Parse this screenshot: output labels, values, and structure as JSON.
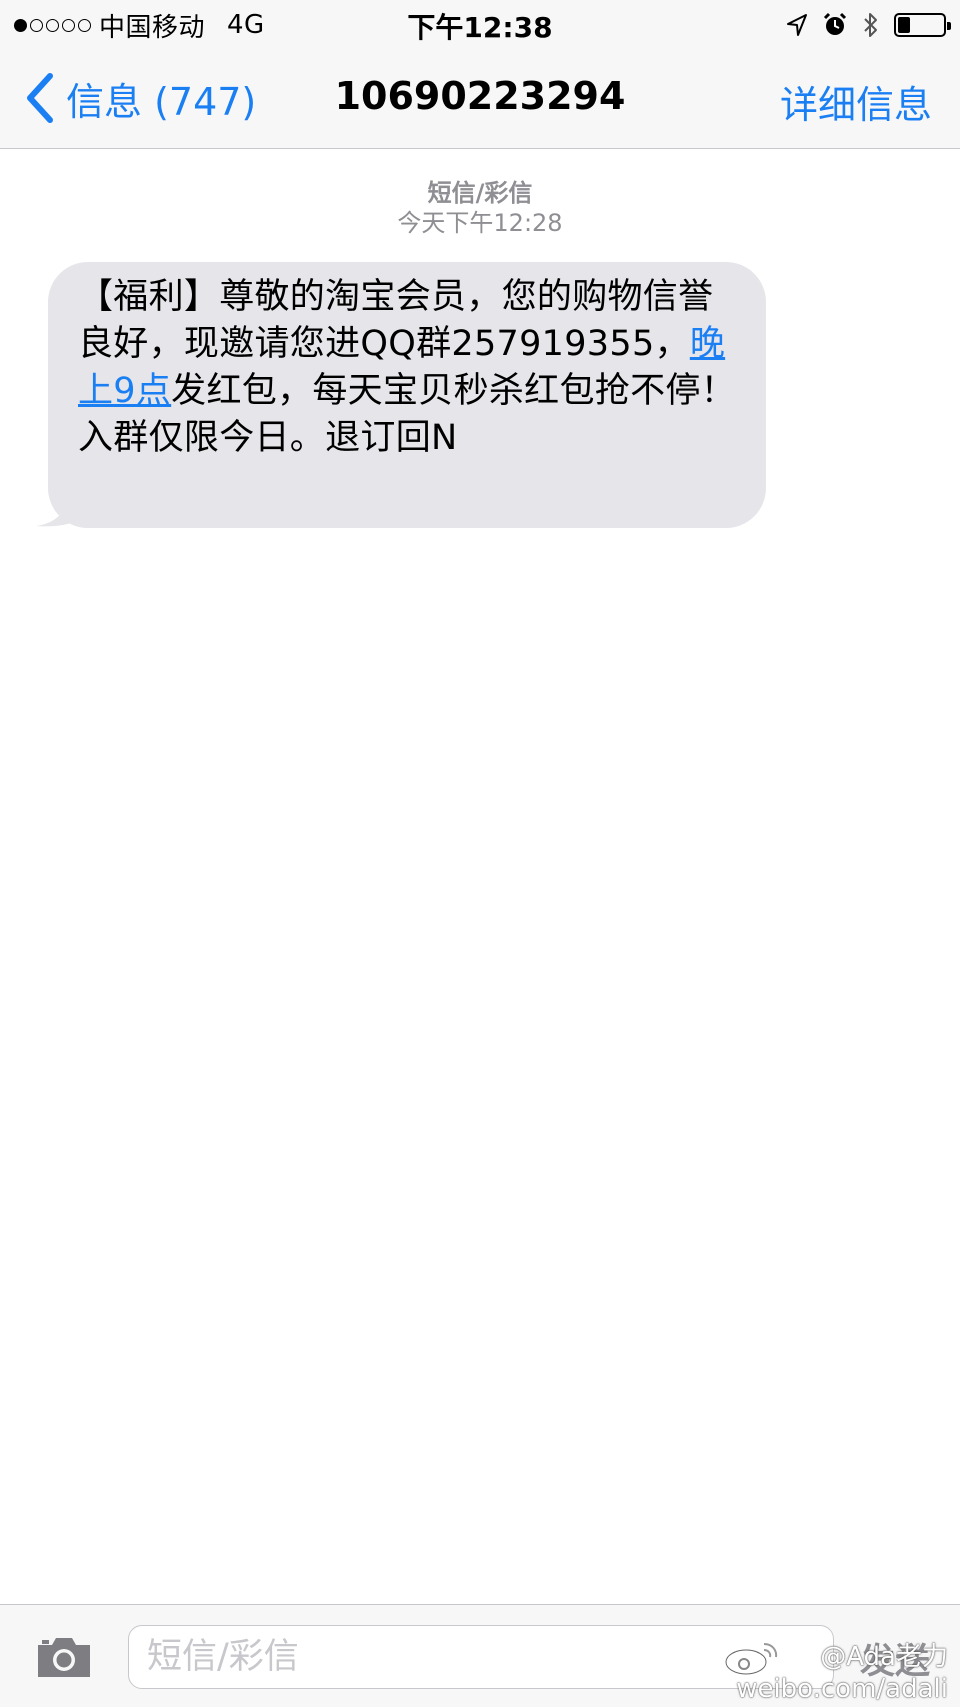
{
  "status_bar": {
    "carrier": "中国移动",
    "network": "4G",
    "time": "下午12:38",
    "battery_level": 0.28
  },
  "nav": {
    "back_label": "信息 (747)",
    "title": "10690223294",
    "details_label": "详细信息"
  },
  "conversation": {
    "message_kind": "短信/彩信",
    "timestamp": "今天下午12:28",
    "message": {
      "before_link": "【福利】尊敬的淘宝会员，您的购物信誉良好，现邀请您进QQ群257919355，",
      "link_text": "晚上9点",
      "after_link": "发红包，每天宝贝秒杀红包抢不停！入群仅限今日。退订回N"
    }
  },
  "input_bar": {
    "placeholder": "短信/彩信",
    "send_label": "发送"
  },
  "watermark": {
    "handle": "@Ada老力",
    "url": "weibo.com/adali"
  },
  "colors": {
    "accent": "#1b7ff4",
    "bubble": "#e5e5ea",
    "bar_bg": "#f7f7f8"
  },
  "icons": [
    "chevron-left-icon",
    "location-arrow-icon",
    "alarm-icon",
    "bluetooth-icon",
    "battery-icon",
    "camera-icon",
    "weibo-logo-icon"
  ]
}
